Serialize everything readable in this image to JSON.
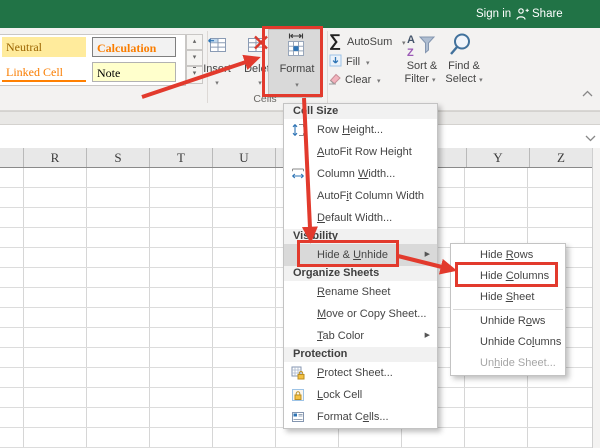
{
  "topbar": {
    "sign_in": "Sign in",
    "share": "Share",
    "bg_color": "#217346"
  },
  "style_gallery": {
    "styles": [
      {
        "label": "Neutral",
        "bg": "#ffeb9c",
        "color": "#9c6500"
      },
      {
        "label": "Calculation",
        "bg": "#f2f2f2",
        "color": "#fa7d00"
      },
      {
        "label": "Linked Cell",
        "bg": "#ffffff",
        "color": "#fa7d00"
      },
      {
        "label": "Note",
        "bg": "#ffffcc",
        "color": "#000000"
      }
    ]
  },
  "ribbon": {
    "cells_group": {
      "label": "Cells",
      "insert": "Insert",
      "delete": "Delete",
      "format": "Format"
    },
    "editing_group": {
      "autosum": "AutoSum",
      "fill": "Fill",
      "clear": "Clear",
      "sort_line1": "Sort &",
      "sort_line2": "Filter",
      "find_line1": "Find &",
      "find_line2": "Select"
    }
  },
  "format_menu": {
    "sections": [
      {
        "header": "Cell Size",
        "items": [
          {
            "pre": "Row ",
            "key": "H",
            "post": "eight..."
          },
          {
            "pre": "",
            "key": "A",
            "post": "utoFit Row Height"
          },
          {
            "pre": "Column ",
            "key": "W",
            "post": "idth..."
          },
          {
            "pre": "AutoF",
            "key": "i",
            "post": "t Column Width"
          },
          {
            "pre": "",
            "key": "D",
            "post": "efault Width..."
          }
        ]
      },
      {
        "header": "Visibility",
        "items": [
          {
            "pre": "Hide & ",
            "key": "U",
            "post": "nhide"
          }
        ]
      },
      {
        "header": "Organize Sheets",
        "items": [
          {
            "pre": "",
            "key": "R",
            "post": "ename Sheet"
          },
          {
            "pre": "",
            "key": "M",
            "post": "ove or Copy Sheet..."
          },
          {
            "pre": "",
            "key": "T",
            "post": "ab Color"
          }
        ]
      },
      {
        "header": "Protection",
        "items": [
          {
            "pre": "",
            "key": "P",
            "post": "rotect Sheet..."
          },
          {
            "pre": "",
            "key": "L",
            "post": "ock Cell"
          },
          {
            "pre": "Format C",
            "key": "e",
            "post": "lls..."
          }
        ]
      }
    ]
  },
  "hide_unhide_submenu": {
    "items": [
      {
        "pre": "Hide ",
        "key": "R",
        "post": "ows"
      },
      {
        "pre": "Hide ",
        "key": "C",
        "post": "olumns"
      },
      {
        "pre": "Hide ",
        "key": "S",
        "post": "heet"
      },
      {
        "pre": "Unhide R",
        "key": "o",
        "post": "ws"
      },
      {
        "pre": "Unhide Co",
        "key": "l",
        "post": "umns"
      },
      {
        "pre": "Un",
        "key": "h",
        "post": "ide Sheet..."
      }
    ]
  },
  "sheet": {
    "visible_columns": [
      {
        "label": "R"
      },
      {
        "label": "S"
      },
      {
        "label": "T"
      },
      {
        "label": "U"
      },
      {
        "label": "Y"
      },
      {
        "label": "Z"
      }
    ]
  },
  "icons": {
    "dropdown_caret": "▾",
    "flyout_arrow": "▶",
    "sigma": "∑",
    "sort_a": "A",
    "sort_z": "Z"
  },
  "annotation": {
    "color": "#e23a2d",
    "highlight_color": "#d9d9d9",
    "accent_blue": "#2e74b5"
  }
}
